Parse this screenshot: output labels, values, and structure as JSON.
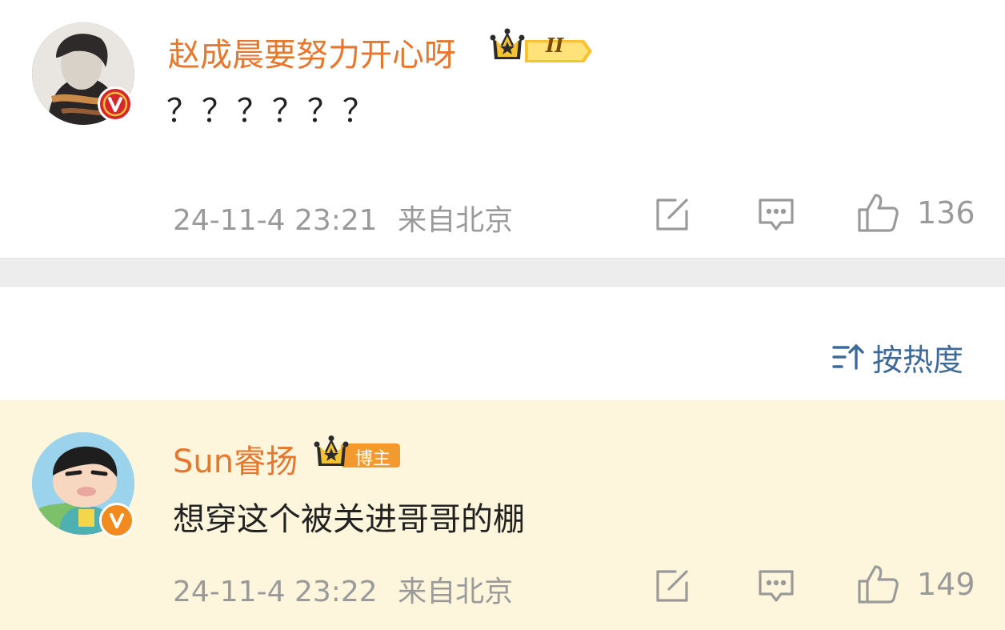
{
  "comments": [
    {
      "username": "赵成晨要努力开心呀",
      "level_badge": "II",
      "badge_icon": "crown-icon",
      "verified_icon": "verified-v-icon",
      "text": "？？？？？？",
      "time": "24-11-4 23:21",
      "location": "来自北京",
      "likes": "136",
      "highlighted": false
    },
    {
      "username": "Sun睿扬",
      "level_badge": "博主",
      "badge_icon": "crown-icon",
      "verified_icon": "verified-v-icon",
      "text": "想穿这个被关进哥哥的棚",
      "time": "24-11-4 23:22",
      "location": "来自北京",
      "likes": "149",
      "highlighted": true
    }
  ],
  "sort": {
    "label": "按热度",
    "icon": "sort-icon"
  },
  "colors": {
    "username": "#e8772e",
    "highlight_bg": "#fdf6dc",
    "sort_link": "#3d6a9a",
    "meta_text": "#9a9a9a",
    "verified_red": "#d7272b",
    "verified_orange": "#f28a1e"
  }
}
